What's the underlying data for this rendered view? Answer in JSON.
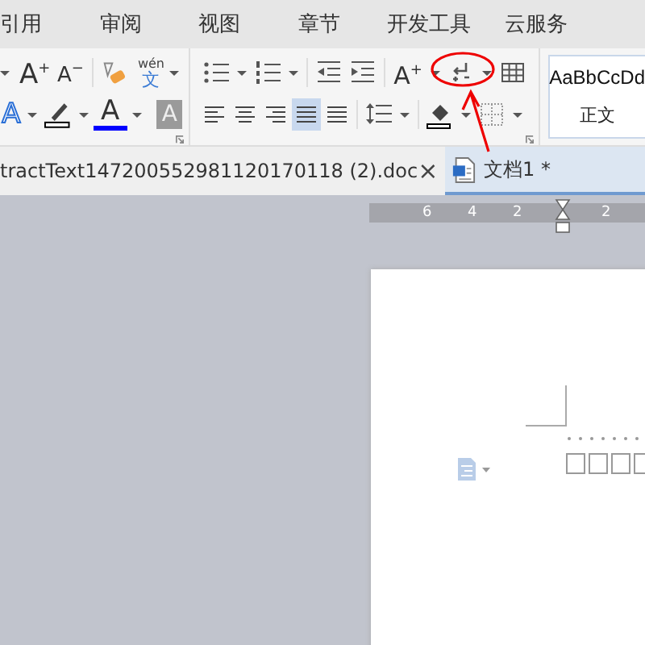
{
  "menu": [
    {
      "label": "引用"
    },
    {
      "label": "审阅"
    },
    {
      "label": "视图"
    },
    {
      "label": "章节"
    },
    {
      "label": "开发工具"
    },
    {
      "label": "云服务"
    }
  ],
  "font_group": {
    "grow": {
      "glyph": "A",
      "sup": "+"
    },
    "shrink": {
      "glyph": "A",
      "sup": "−"
    },
    "phonetic": {
      "pinyin": "wén",
      "char": "文"
    },
    "text_effect": "A",
    "font_color": "A",
    "char_shading": "A"
  },
  "paragraph_group": {
    "font_size_glyph": {
      "glyph": "A",
      "sup": "+"
    },
    "alignment": [
      {
        "selected": false
      },
      {
        "selected": false
      },
      {
        "selected": false
      },
      {
        "selected": true
      },
      {
        "selected": false
      }
    ]
  },
  "style_gallery": {
    "preview": "AaBbCcDd",
    "name": "正文"
  },
  "tabs": [
    {
      "label": "tractText147200552981120170118 (2).doc",
      "close": "×",
      "selected": false
    },
    {
      "label": "文档1 *",
      "selected": true
    }
  ],
  "ruler": {
    "labels": [
      "6",
      "4",
      "2",
      "2"
    ]
  }
}
